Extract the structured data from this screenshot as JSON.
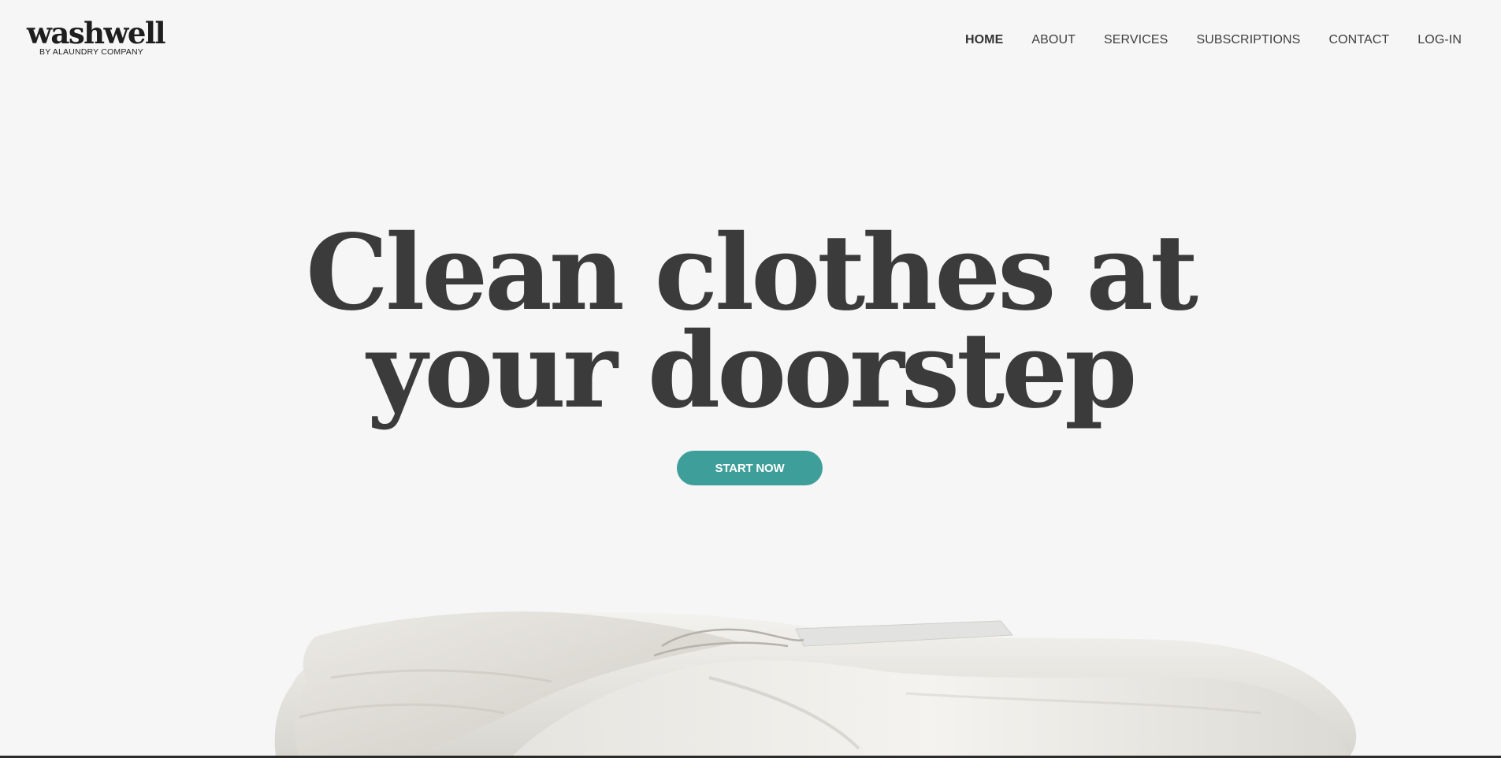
{
  "brand": {
    "name": "washwell",
    "tagline": "BY ALAUNDRY COMPANY"
  },
  "nav": {
    "items": [
      {
        "label": "HOME",
        "active": true
      },
      {
        "label": "ABOUT",
        "active": false
      },
      {
        "label": "SERVICES",
        "active": false
      },
      {
        "label": "SUBSCRIPTIONS",
        "active": false
      },
      {
        "label": "CONTACT",
        "active": false
      },
      {
        "label": "LOG-IN",
        "active": false
      }
    ]
  },
  "hero": {
    "title_line1": "Clean clothes at",
    "title_line2": "your doorstep",
    "cta_label": "START NOW"
  },
  "colors": {
    "background": "#f6f6f6",
    "text": "#3b3b3b",
    "accent": "#3e9e9a"
  },
  "image": {
    "subject": "folded-white-laundry-image"
  }
}
